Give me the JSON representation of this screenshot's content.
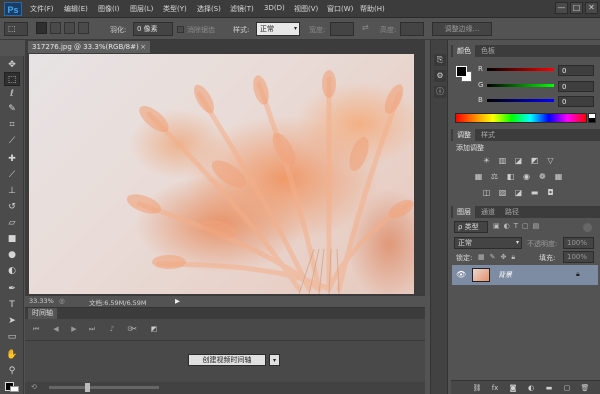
{
  "app": {
    "logo": "Ps"
  },
  "menu": [
    "文件(F)",
    "编辑(E)",
    "图像(I)",
    "图层(L)",
    "类型(Y)",
    "选择(S)",
    "滤镜(T)",
    "3D(D)",
    "视图(V)",
    "窗口(W)",
    "帮助(H)"
  ],
  "window_controls": [
    "—",
    "□",
    "✕"
  ],
  "options": {
    "feather_label": "羽化:",
    "feather_value": "0 像素",
    "antialias_label": "消除锯齿",
    "style_label": "样式:",
    "style_value": "正常",
    "width_label": "宽度:",
    "height_label": "高度:",
    "refine_edge": "调整边缘..."
  },
  "document": {
    "tab": "317276.jpg @ 33.3%(RGB/8#)",
    "zoom": "33.33%",
    "doc_info": "文档:6.59M/6.59M"
  },
  "timeline": {
    "tab": "时间轴",
    "create_button": "创建视频时间轴",
    "dropdown_glyph": "▾"
  },
  "color_panel": {
    "tabs": [
      "颜色",
      "色板"
    ],
    "channels": [
      {
        "label": "R",
        "value": "0",
        "color": "#ff0000"
      },
      {
        "label": "G",
        "value": "0",
        "color": "#00c000"
      },
      {
        "label": "B",
        "value": "0",
        "color": "#0000ff"
      }
    ]
  },
  "adjustments_panel": {
    "tabs": [
      "调整",
      "样式"
    ],
    "title": "添加调整"
  },
  "layers_panel": {
    "tabs": [
      "图层",
      "通道",
      "路径"
    ],
    "filter_label": "ρ 类型",
    "blend_mode": "正常",
    "opacity_label": "不透明度:",
    "opacity_value": "100%",
    "lock_label": "锁定:",
    "fill_label": "填充:",
    "fill_value": "100%",
    "layer_name": "背景"
  },
  "tools": [
    "selection-move",
    "rect-marquee",
    "lasso",
    "quick-select",
    "crop",
    "eyedropper",
    "healing",
    "brush",
    "clone-stamp",
    "history-brush",
    "eraser",
    "gradient",
    "blur",
    "dodge",
    "pen",
    "type",
    "path-select",
    "rectangle-shape",
    "hand",
    "zoom"
  ]
}
